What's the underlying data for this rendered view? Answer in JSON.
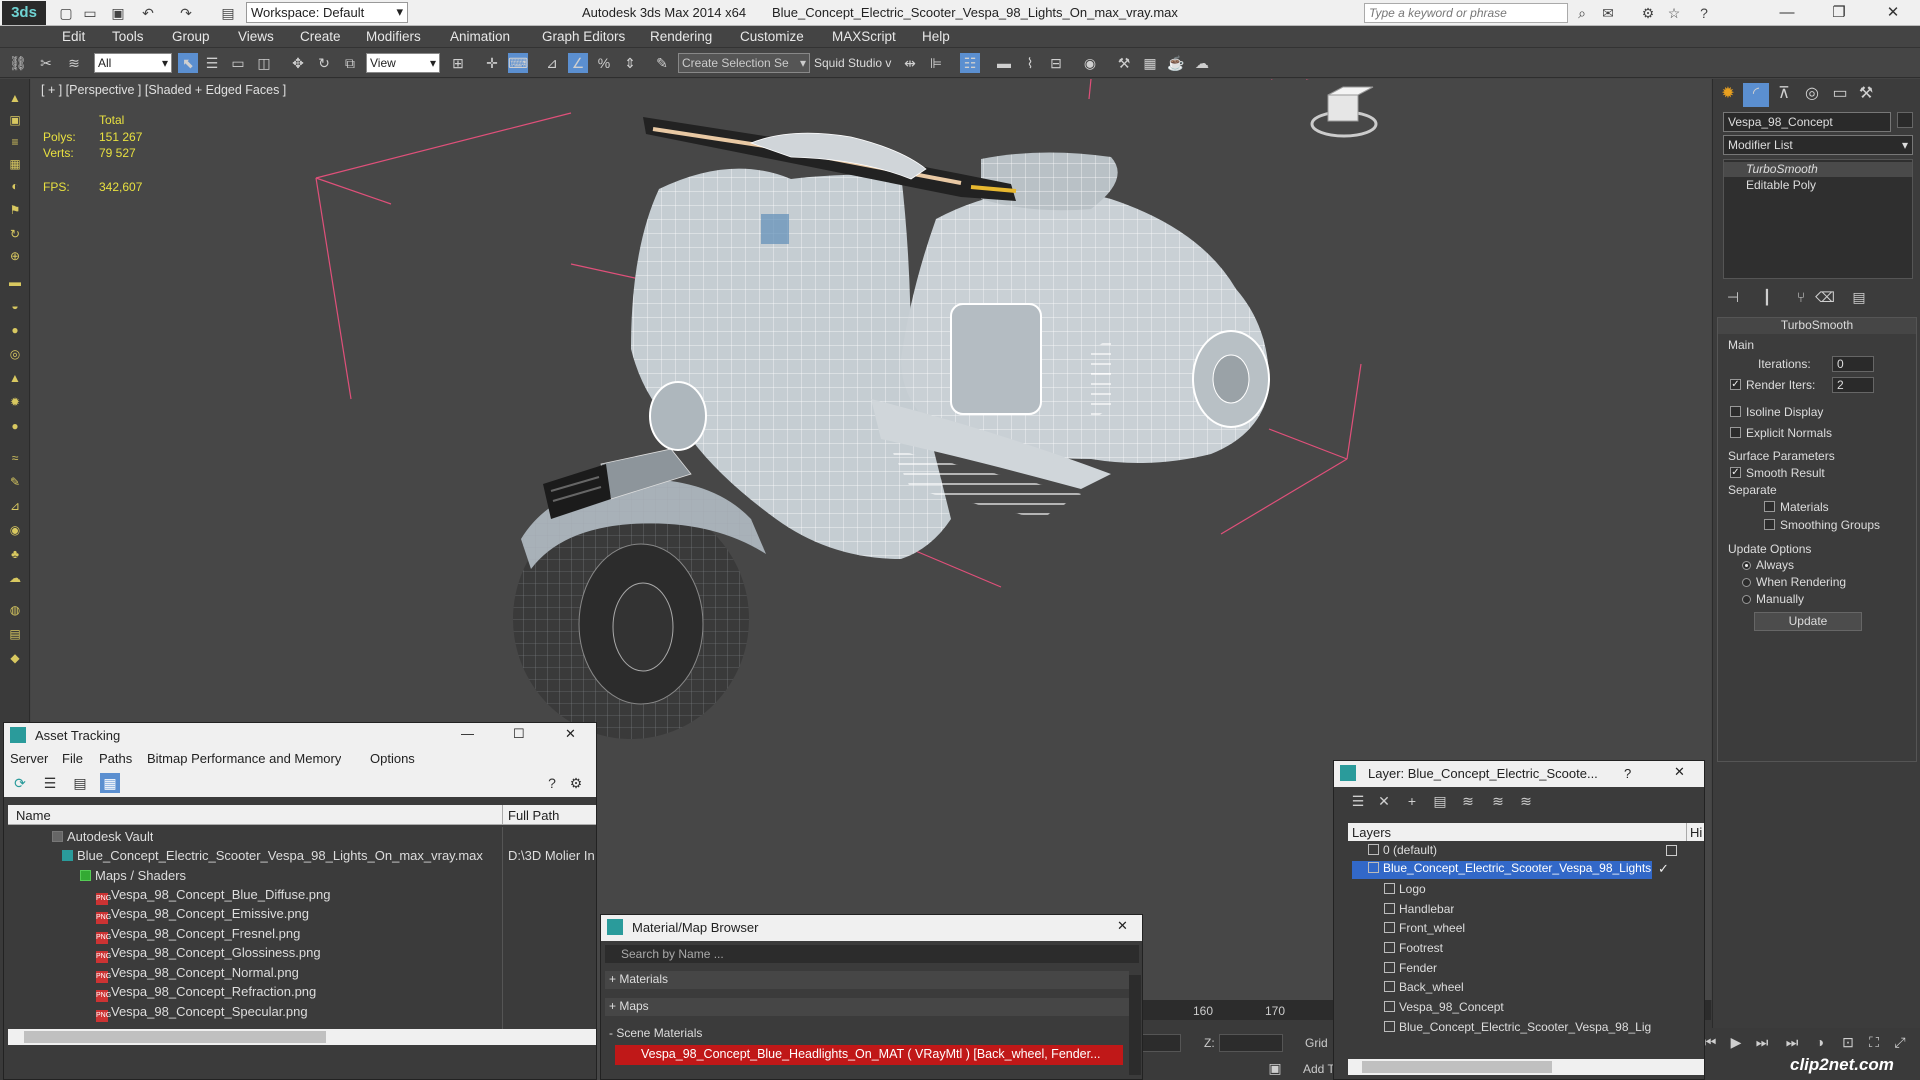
{
  "title_bar": {
    "app_logo": "3ds",
    "workspace": "Workspace: Default",
    "app_title": "Autodesk 3ds Max  2014 x64",
    "file_title": "Blue_Concept_Electric_Scooter_Vespa_98_Lights_On_max_vray.max",
    "search_placeholder": "Type a keyword or phrase"
  },
  "menu": [
    "Edit",
    "Tools",
    "Group",
    "Views",
    "Create",
    "Modifiers",
    "Animation",
    "Graph Editors",
    "Rendering",
    "Customize",
    "MAXScript",
    "Help"
  ],
  "toolbar": {
    "filter_value": "All",
    "coord_value": "View",
    "selection_set": "Create Selection Se",
    "studio_label": "Squid Studio v"
  },
  "viewport": {
    "label": "[ + ] [Perspective ] [Shaded + Edged Faces ]",
    "stats": {
      "total_label": "Total",
      "polys_label": "Polys:",
      "polys_value": "151 267",
      "verts_label": "Verts:",
      "verts_value": "79 527",
      "fps_label": "FPS:",
      "fps_value": "342,607"
    }
  },
  "command_panel": {
    "object_name": "Vespa_98_Concept",
    "modifier_list": "Modifier List",
    "stack": [
      "TurboSmooth",
      "Editable Poly"
    ],
    "rollout_title": "TurboSmooth",
    "main_label": "Main",
    "iterations_label": "Iterations:",
    "iterations_value": "0",
    "render_iters_label": "Render Iters:",
    "render_iters_value": "2",
    "isoline_label": "Isoline Display",
    "explicit_label": "Explicit Normals",
    "surface_label": "Surface Parameters",
    "smooth_result_label": "Smooth Result",
    "separate_label": "Separate",
    "materials_label": "Materials",
    "smoothing_groups_label": "Smoothing Groups",
    "update_options_label": "Update Options",
    "always_label": "Always",
    "when_rendering_label": "When Rendering",
    "manually_label": "Manually",
    "update_button": "Update"
  },
  "asset_tracking": {
    "title": "Asset Tracking",
    "menu": [
      "Server",
      "File",
      "Paths",
      "Bitmap Performance and Memory",
      "Options"
    ],
    "col_name": "Name",
    "col_path": "Full Path",
    "vault": "Autodesk Vault",
    "file": "Blue_Concept_Electric_Scooter_Vespa_98_Lights_On_max_vray.max",
    "file_path": "D:\\3D Molier In",
    "maps_folder": "Maps / Shaders",
    "maps": [
      "Vespa_98_Concept_Blue_Diffuse.png",
      "Vespa_98_Concept_Emissive.png",
      "Vespa_98_Concept_Fresnel.png",
      "Vespa_98_Concept_Glossiness.png",
      "Vespa_98_Concept_Normal.png",
      "Vespa_98_Concept_Refraction.png",
      "Vespa_98_Concept_Specular.png"
    ]
  },
  "material_browser": {
    "title": "Material/Map Browser",
    "search_placeholder": "Search by Name ...",
    "materials": "+ Materials",
    "maps": "+ Maps",
    "scene_materials": "- Scene Materials",
    "scene_item": "Vespa_98_Concept_Blue_Headlights_On_MAT ( VRayMtl ) [Back_wheel, Fender..."
  },
  "layer_window": {
    "title": "Layer: Blue_Concept_Electric_Scoote...",
    "col_layers": "Layers",
    "col_hide": "Hi",
    "default_layer": "0 (default)",
    "active_layer": "Blue_Concept_Electric_Scooter_Vespa_98_Lights",
    "objects": [
      "Logo",
      "Handlebar",
      "Front_wheel",
      "Footrest",
      "Fender",
      "Back_wheel",
      "Vespa_98_Concept",
      "Blue_Concept_Electric_Scooter_Vespa_98_Lig"
    ]
  },
  "timeline": {
    "ticks": [
      "160",
      "170"
    ],
    "z_label": "Z:",
    "grid_label": "Grid",
    "add_label": "Add T"
  },
  "watermark": "clip2net.com"
}
